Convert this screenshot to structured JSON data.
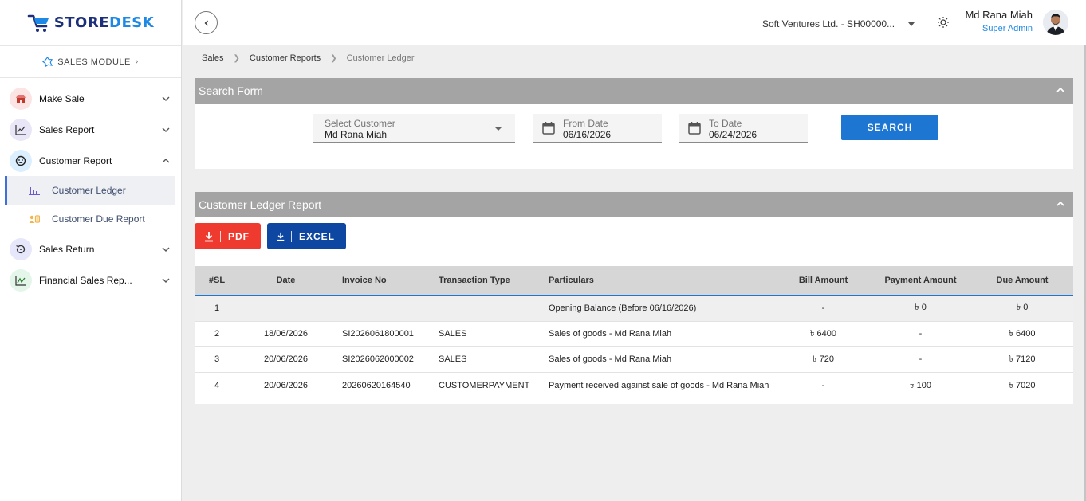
{
  "brand": {
    "logo_part1": "STORE",
    "logo_part2": "DESK"
  },
  "module": {
    "label": "SALES MODULE"
  },
  "sidebar": {
    "items": [
      {
        "label": "Make Sale",
        "icon": "shop-icon",
        "color": "#fde4e4"
      },
      {
        "label": "Sales Report",
        "icon": "line-chart-icon",
        "color": "#e9e6f7"
      },
      {
        "label": "Customer Report",
        "icon": "user-face-icon",
        "color": "#dcefff"
      },
      {
        "label": "Sales Return",
        "icon": "history-icon",
        "color": "#e6e7fb"
      },
      {
        "label": "Financial Sales Rep...",
        "icon": "finance-chart-icon",
        "color": "#e4f6ea"
      }
    ],
    "sub_items": [
      {
        "label": "Customer Ledger",
        "icon": "bar-chart-icon"
      },
      {
        "label": "Customer Due Report",
        "icon": "id-card-icon"
      }
    ]
  },
  "header": {
    "company": "Soft Ventures Ltd. - SH00000...",
    "user_name": "Md Rana Miah",
    "user_role": "Super Admin"
  },
  "breadcrumb": [
    "Sales",
    "Customer Reports",
    "Customer Ledger"
  ],
  "search_form": {
    "title": "Search Form",
    "customer_label": "Select Customer",
    "customer_value": "Md Rana Miah",
    "from_label": "From Date",
    "from_value": "06/16/2026",
    "to_label": "To Date",
    "to_value": "06/24/2026",
    "search_label": "SEARCH"
  },
  "report": {
    "title": "Customer Ledger Report",
    "pdf_label": "PDF",
    "excel_label": "EXCEL",
    "columns": [
      "#SL",
      "Date",
      "Invoice No",
      "Transaction Type",
      "Particulars",
      "Bill Amount",
      "Payment Amount",
      "Due Amount"
    ],
    "rows": [
      [
        "1",
        "",
        "",
        "",
        "Opening Balance (Before 06/16/2026)",
        "-",
        "৳ 0",
        "৳ 0"
      ],
      [
        "2",
        "18/06/2026",
        "SI2026061800001",
        "SALES",
        "Sales of goods - Md Rana Miah",
        "৳ 6400",
        "-",
        "৳ 6400"
      ],
      [
        "3",
        "20/06/2026",
        "SI2026062000002",
        "SALES",
        "Sales of goods - Md Rana Miah",
        "৳ 720",
        "-",
        "৳ 7120"
      ],
      [
        "4",
        "20/06/2026",
        "20260620164540",
        "CUSTOMERPAYMENT",
        "Payment received against sale of goods - Md Rana Miah",
        "-",
        "৳ 100",
        "৳ 7020"
      ]
    ]
  },
  "colors": {
    "primary_blue": "#1e76d3",
    "pdf_red": "#ef3b2f",
    "excel_navy": "#0d47a1",
    "panel_header": "#a4a4a4"
  }
}
